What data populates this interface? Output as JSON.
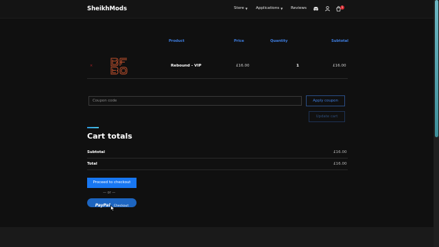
{
  "header": {
    "logo": "SheikhMods",
    "nav": [
      {
        "label": "Store",
        "has_dropdown": true
      },
      {
        "label": "Applications",
        "has_dropdown": true
      },
      {
        "label": "Reviews",
        "has_dropdown": false
      }
    ],
    "icons": [
      "discord-icon",
      "user-icon",
      "cart-icon"
    ],
    "cart_count": "1"
  },
  "cart_table": {
    "columns": [
      "Product",
      "Price",
      "Quantity",
      "Subtotal"
    ],
    "rows": [
      {
        "remove": "×",
        "thumbnail": "rebound-logo",
        "product": "Rebound - VIP",
        "price": "£16.00",
        "quantity": "1",
        "subtotal": "£16.00"
      }
    ]
  },
  "coupon": {
    "placeholder": "Coupon code",
    "apply_label": "Apply coupon",
    "update_label": "Update cart"
  },
  "totals": {
    "title": "Cart totals",
    "subtotal_label": "Subtotal",
    "subtotal_value": "£16.00",
    "total_label": "Total",
    "total_value": "£16.00"
  },
  "checkout": {
    "proceed_label": "Proceed to checkout",
    "or_label": "— or —",
    "paypal_logo": "PayPal",
    "paypal_label": "Checkout"
  },
  "colors": {
    "accent": "#1877f2",
    "header_link": "#3f7fe3",
    "remove": "#b8242a",
    "background": "#101010"
  }
}
